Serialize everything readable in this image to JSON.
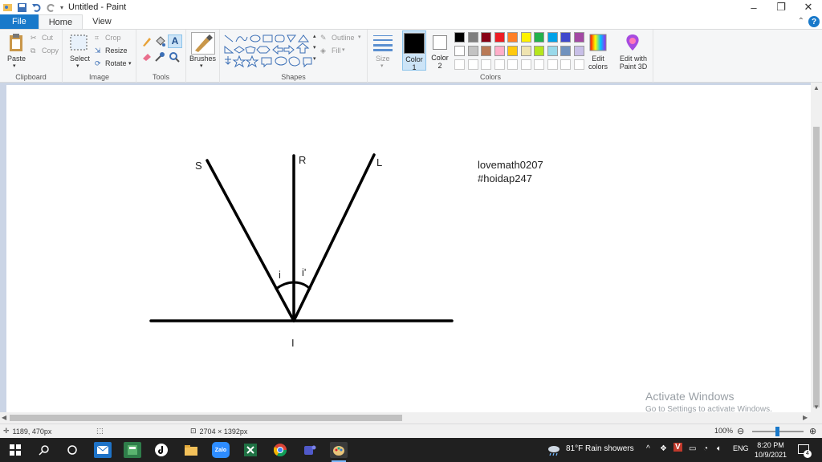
{
  "window": {
    "title": "Untitled - Paint",
    "minimize": "–",
    "maximize": "❐",
    "close": "✕"
  },
  "tabs": {
    "file": "File",
    "home": "Home",
    "view": "View",
    "help": "?"
  },
  "ribbon": {
    "clipboard": {
      "label": "Clipboard",
      "paste": "Paste",
      "cut": "Cut",
      "copy": "Copy"
    },
    "image": {
      "label": "Image",
      "select": "Select",
      "crop": "Crop",
      "resize": "Resize",
      "rotate": "Rotate"
    },
    "tools": {
      "label": "Tools"
    },
    "brushes": {
      "label": "Brushes"
    },
    "shapes": {
      "label": "Shapes",
      "outline": "Outline",
      "fill": "Fill"
    },
    "size": {
      "label": "Size"
    },
    "colors": {
      "label": "Colors",
      "color1": "Color",
      "color1_num": "1",
      "color2": "Color",
      "color2_num": "2",
      "edit_colors_1": "Edit",
      "edit_colors_2": "colors",
      "paint3d_1": "Edit with",
      "paint3d_2": "Paint 3D",
      "color1_value": "#000000",
      "color2_value": "#ffffff",
      "palette_row1": [
        "#000000",
        "#7f7f7f",
        "#880015",
        "#ed1c24",
        "#ff7f27",
        "#fff200",
        "#22b14c",
        "#00a2e8",
        "#3f48cc",
        "#a349a4"
      ],
      "palette_row2": [
        "#ffffff",
        "#c3c3c3",
        "#b97a57",
        "#ffaec9",
        "#ffc90e",
        "#efe4b0",
        "#b5e61d",
        "#99d9ea",
        "#7092be",
        "#c8bfe7"
      ]
    }
  },
  "drawing": {
    "label_s": "S",
    "label_r": "R",
    "label_l": "L",
    "label_i": "i",
    "label_i_prime": "i'",
    "label_point": "I",
    "note_line1": "lovemath0207",
    "note_line2": "#hoidap247"
  },
  "watermark": {
    "line1": "Activate Windows",
    "line2": "Go to Settings to activate Windows."
  },
  "status": {
    "cursor_pos": "1189, 470px",
    "canvas_size": "2704 × 1392px",
    "zoom": "100%"
  },
  "taskbar": {
    "weather": "81°F  Rain showers",
    "lang": "ENG",
    "time": "8:20 PM",
    "date": "10/9/2021"
  }
}
